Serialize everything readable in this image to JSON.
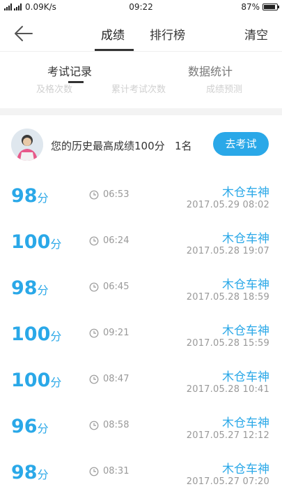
{
  "status": {
    "carrier_text": "4G 4G",
    "net_speed": "0.09K/s",
    "time": "09:22",
    "battery": "87%",
    "battery_level": 0.87
  },
  "header": {
    "tabs": [
      {
        "label": "成绩",
        "active": true
      },
      {
        "label": "排行榜",
        "active": false
      }
    ],
    "clear_label": "清空"
  },
  "subtabs": [
    {
      "label": "考试记录",
      "active": true
    },
    {
      "label": "数据统计",
      "active": false
    }
  ],
  "stats_labels": [
    "及格次数",
    "累计考试次数",
    "成绩预测"
  ],
  "summary": {
    "text": "您的历史最高成绩100分",
    "rank": "1名",
    "button_label": "去考试"
  },
  "records": [
    {
      "score": "98",
      "unit": "分",
      "duration": "06:53",
      "name": "木仓车神",
      "date": "2017.05.29  08:02"
    },
    {
      "score": "100",
      "unit": "分",
      "duration": "06:24",
      "name": "木仓车神",
      "date": "2017.05.28  19:07"
    },
    {
      "score": "98",
      "unit": "分",
      "duration": "06:45",
      "name": "木仓车神",
      "date": "2017.05.28  18:59"
    },
    {
      "score": "100",
      "unit": "分",
      "duration": "09:21",
      "name": "木仓车神",
      "date": "2017.05.28  15:59"
    },
    {
      "score": "100",
      "unit": "分",
      "duration": "08:47",
      "name": "木仓车神",
      "date": "2017.05.28  10:41"
    },
    {
      "score": "96",
      "unit": "分",
      "duration": "08:58",
      "name": "木仓车神",
      "date": "2017.05.27  12:12"
    },
    {
      "score": "98",
      "unit": "分",
      "duration": "08:31",
      "name": "木仓车神",
      "date": "2017.05.27  07:20"
    }
  ],
  "colors": {
    "accent": "#2aa8e8",
    "muted": "#999999"
  },
  "icons": {
    "back": "arrow-left-icon",
    "clock": "clock-icon",
    "avatar": "user-avatar"
  }
}
